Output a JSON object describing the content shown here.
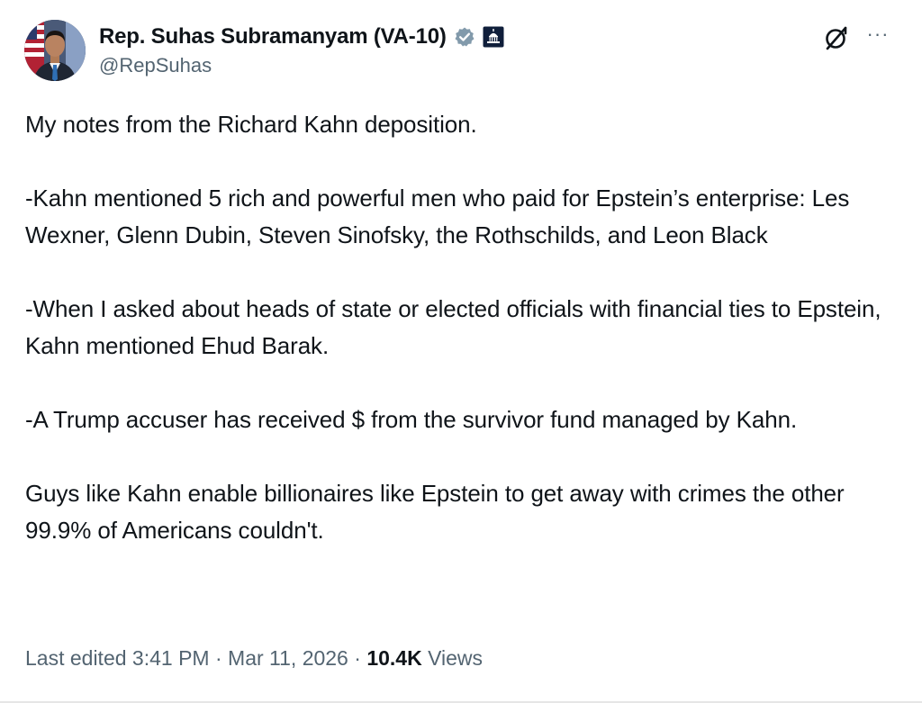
{
  "author": {
    "display_name": "Rep. Suhas Subramanyam (VA-10)",
    "handle": "@RepSuhas",
    "avatar_icon": "profile-photo",
    "verified_badge_icon": "verified-badge-icon",
    "verified_color": "#829aab",
    "affiliation_icon": "capitol-building-icon"
  },
  "tweet": {
    "paragraphs": [
      "My notes from the Richard Kahn deposition.",
      "-Kahn mentioned 5 rich and powerful men who paid for Epstein’s enterprise: Les Wexner, Glenn Dubin, Steven Sinofsky, the Rothschilds, and Leon Black",
      "-When I asked about heads of state or elected officials with financial ties to Epstein, Kahn mentioned Ehud Barak.",
      "-A Trump accuser has received $ from the survivor fund managed by Kahn.",
      "Guys like Kahn enable billionaires like Epstein to get away with crimes the other 99.9% of Americans couldn't."
    ]
  },
  "meta": {
    "edited_label": "Last edited 3:41 PM",
    "separator": " · ",
    "date": "Mar 11, 2026",
    "views_count": "10.4K",
    "views_label": "Views"
  },
  "icons": {
    "grok": "grok-icon",
    "more": "more-options-icon",
    "more_glyph": "···"
  }
}
